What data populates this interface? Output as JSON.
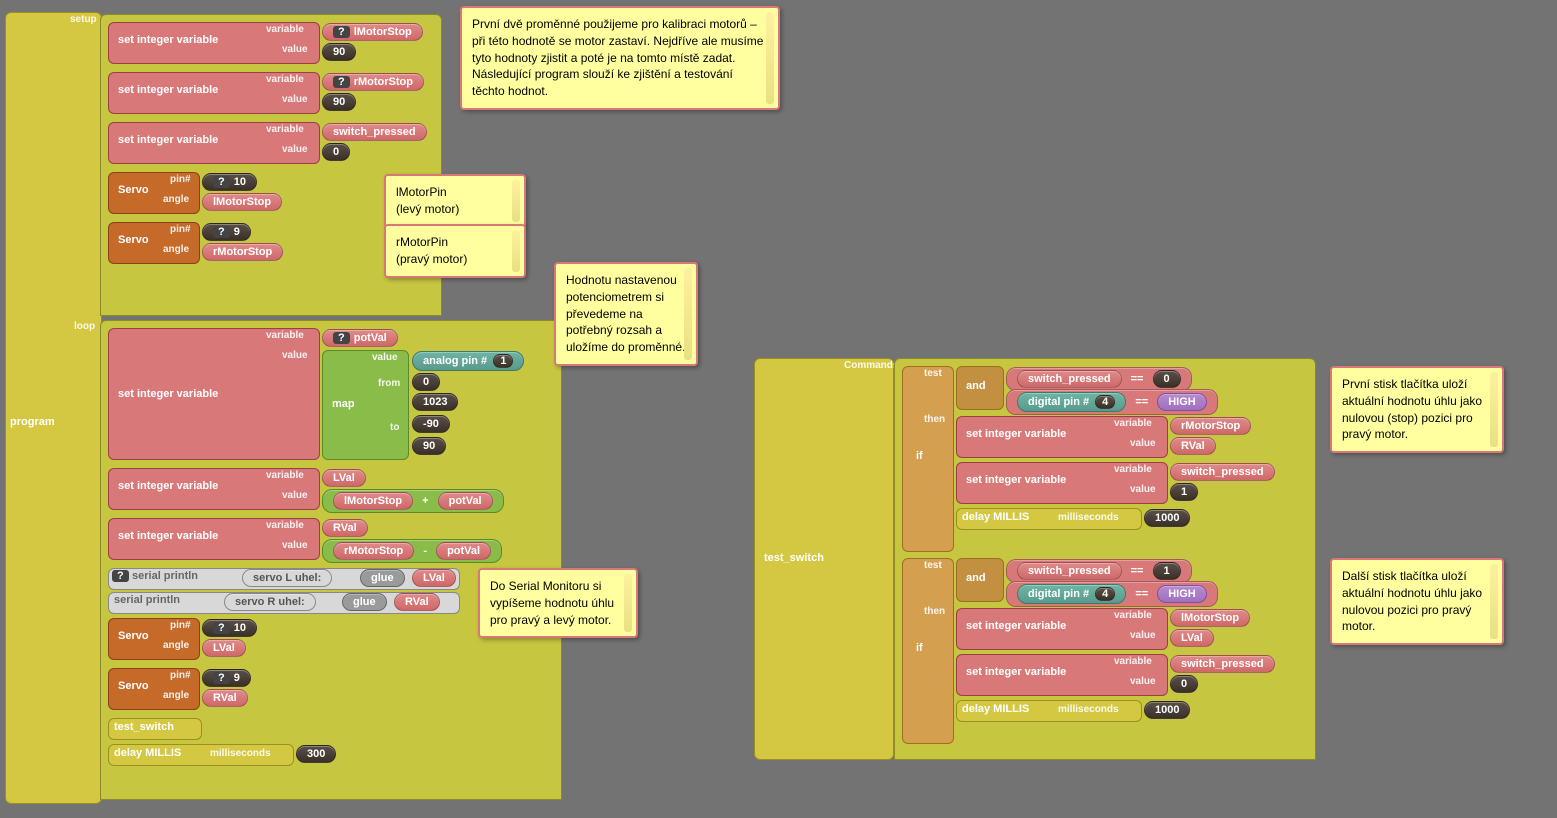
{
  "program": {
    "label": "program",
    "setup_label": "setup",
    "loop_label": "loop"
  },
  "setup": {
    "set1": {
      "op": "set integer variable",
      "varlbl": "variable",
      "var": "lMotorStop",
      "vallbl": "value",
      "val": "90",
      "q": "?"
    },
    "set2": {
      "op": "set integer variable",
      "varlbl": "variable",
      "var": "rMotorStop",
      "vallbl": "value",
      "val": "90",
      "q": "?"
    },
    "set3": {
      "op": "set integer variable",
      "varlbl": "variable",
      "var": "switch_pressed",
      "vallbl": "value",
      "val": "0"
    },
    "servo1": {
      "op": "Servo",
      "pinlbl": "pin#",
      "pin": "10",
      "anglelbl": "angle",
      "angle": "lMotorStop",
      "q": "?"
    },
    "servo2": {
      "op": "Servo",
      "pinlbl": "pin#",
      "pin": "9",
      "anglelbl": "angle",
      "angle": "rMotorStop",
      "q": "?"
    }
  },
  "loop": {
    "set1": {
      "op": "set integer variable",
      "varlbl": "variable",
      "var": "potVal",
      "vallbl": "value",
      "q": "?"
    },
    "map": {
      "op": "map",
      "vallbl": "value",
      "fromlbl": "from",
      "tolbl": "to",
      "analog": "analog pin #",
      "apin": "1",
      "v0": "0",
      "v1": "1023",
      "v2": "-90",
      "v3": "90"
    },
    "set2": {
      "op": "set integer variable",
      "varlbl": "variable",
      "var": "LVal",
      "vallbl": "value",
      "expr_a": "lMotorStop",
      "expr_op": "+",
      "expr_b": "potVal"
    },
    "set3": {
      "op": "set integer variable",
      "varlbl": "variable",
      "var": "RVal",
      "vallbl": "value",
      "expr_a": "rMotorStop",
      "expr_op": "-",
      "expr_b": "potVal"
    },
    "print1": {
      "op": "serial println",
      "s": "servo L uhel:",
      "glue": "glue",
      "v": "LVal",
      "q": "?"
    },
    "print2": {
      "op": "serial println",
      "s": "servo R uhel:",
      "glue": "glue",
      "v": "RVal"
    },
    "servo1": {
      "op": "Servo",
      "pinlbl": "pin#",
      "pin": "10",
      "anglelbl": "angle",
      "angle": "LVal",
      "q": "?"
    },
    "servo2": {
      "op": "Servo",
      "pinlbl": "pin#",
      "pin": "9",
      "anglelbl": "angle",
      "angle": "RVal",
      "q": "?"
    },
    "call": {
      "op": "test_switch"
    },
    "delay": {
      "op": "delay MILLIS",
      "lbl": "milliseconds",
      "v": "300"
    }
  },
  "test_switch": {
    "label": "test_switch",
    "commands": "Commands",
    "if1": {
      "iflbl": "if",
      "testlbl": "test",
      "thenlbl": "then",
      "andlbl": "and",
      "cond_a": "switch_pressed",
      "cond_aop": "==",
      "cond_av": "0",
      "cond_b": "digital pin #",
      "cond_bpin": "4",
      "cond_bop": "==",
      "cond_bv": "HIGH",
      "q": "?",
      "set1": {
        "op": "set integer variable",
        "varlbl": "variable",
        "var": "rMotorStop",
        "vallbl": "value",
        "val": "RVal"
      },
      "set2": {
        "op": "set integer variable",
        "varlbl": "variable",
        "var": "switch_pressed",
        "vallbl": "value",
        "val": "1"
      },
      "delay": {
        "op": "delay MILLIS",
        "lbl": "milliseconds",
        "v": "1000"
      }
    },
    "if2": {
      "iflbl": "if",
      "testlbl": "test",
      "thenlbl": "then",
      "andlbl": "and",
      "cond_a": "switch_pressed",
      "cond_aop": "==",
      "cond_av": "1",
      "cond_b": "digital pin #",
      "cond_bpin": "4",
      "cond_bop": "==",
      "cond_bv": "HIGH",
      "q": "?",
      "set1": {
        "op": "set integer variable",
        "varlbl": "variable",
        "var": "lMotorStop",
        "vallbl": "value",
        "val": "LVal"
      },
      "set2": {
        "op": "set integer variable",
        "varlbl": "variable",
        "var": "switch_pressed",
        "vallbl": "value",
        "val": "0"
      },
      "delay": {
        "op": "delay MILLIS",
        "lbl": "milliseconds",
        "v": "1000"
      }
    }
  },
  "notes": {
    "n1": "První dvě proměnné použijeme pro kalibraci motorů – při této hodnotě se motor zastaví. Nejdříve ale musíme tyto hodnoty zjistit a poté je na tomto místě zadat. Následující program slouží ke zjištění a testování těchto hodnot.",
    "n2": "lMotorPin\n(levý motor)",
    "n3": "rMotorPin\n(pravý motor)",
    "n4": "Hodnotu nastavenou potenciometrem si převedeme na potřebný rozsah a uložíme do proměnné.",
    "n5": "Do Serial Monitoru si vypíšeme hodnotu úhlu pro pravý a levý motor.",
    "n6": "První stisk tlačítka uloží aktuální hodnotu úhlu jako nulovou (stop) pozici pro pravý motor.",
    "n7": "Další stisk tlačítka uloží aktuální hodnotu úhlu jako nulovou pozici pro pravý motor."
  }
}
